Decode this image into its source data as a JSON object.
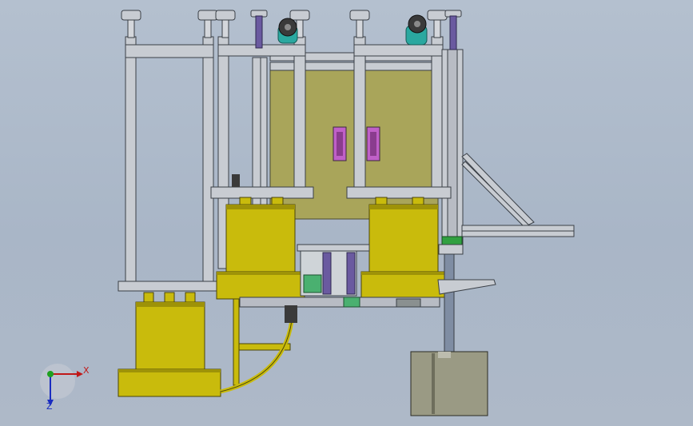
{
  "viewport": {
    "background_top": "#b4c0cf",
    "background_bottom": "#aeb9c8"
  },
  "colors": {
    "frame_fill": "#c8ccd2",
    "frame_stroke": "#3a3f46",
    "cylinder_fill": "#c9bb0c",
    "cylinder_shade": "#9e9208",
    "panel_fill": "#a9a55a",
    "handle_fill": "#c060c8",
    "teal": "#2aa8a0",
    "rod": "#7f8da3",
    "rod_accent": "#6a5aa0",
    "green_band": "#30a040",
    "motor_box": "#9a9a84"
  },
  "triad": {
    "x_label": "X",
    "z_label": "Z",
    "x_color": "#c01818",
    "y_color": "#1fa020",
    "z_color": "#1a2cc0"
  }
}
